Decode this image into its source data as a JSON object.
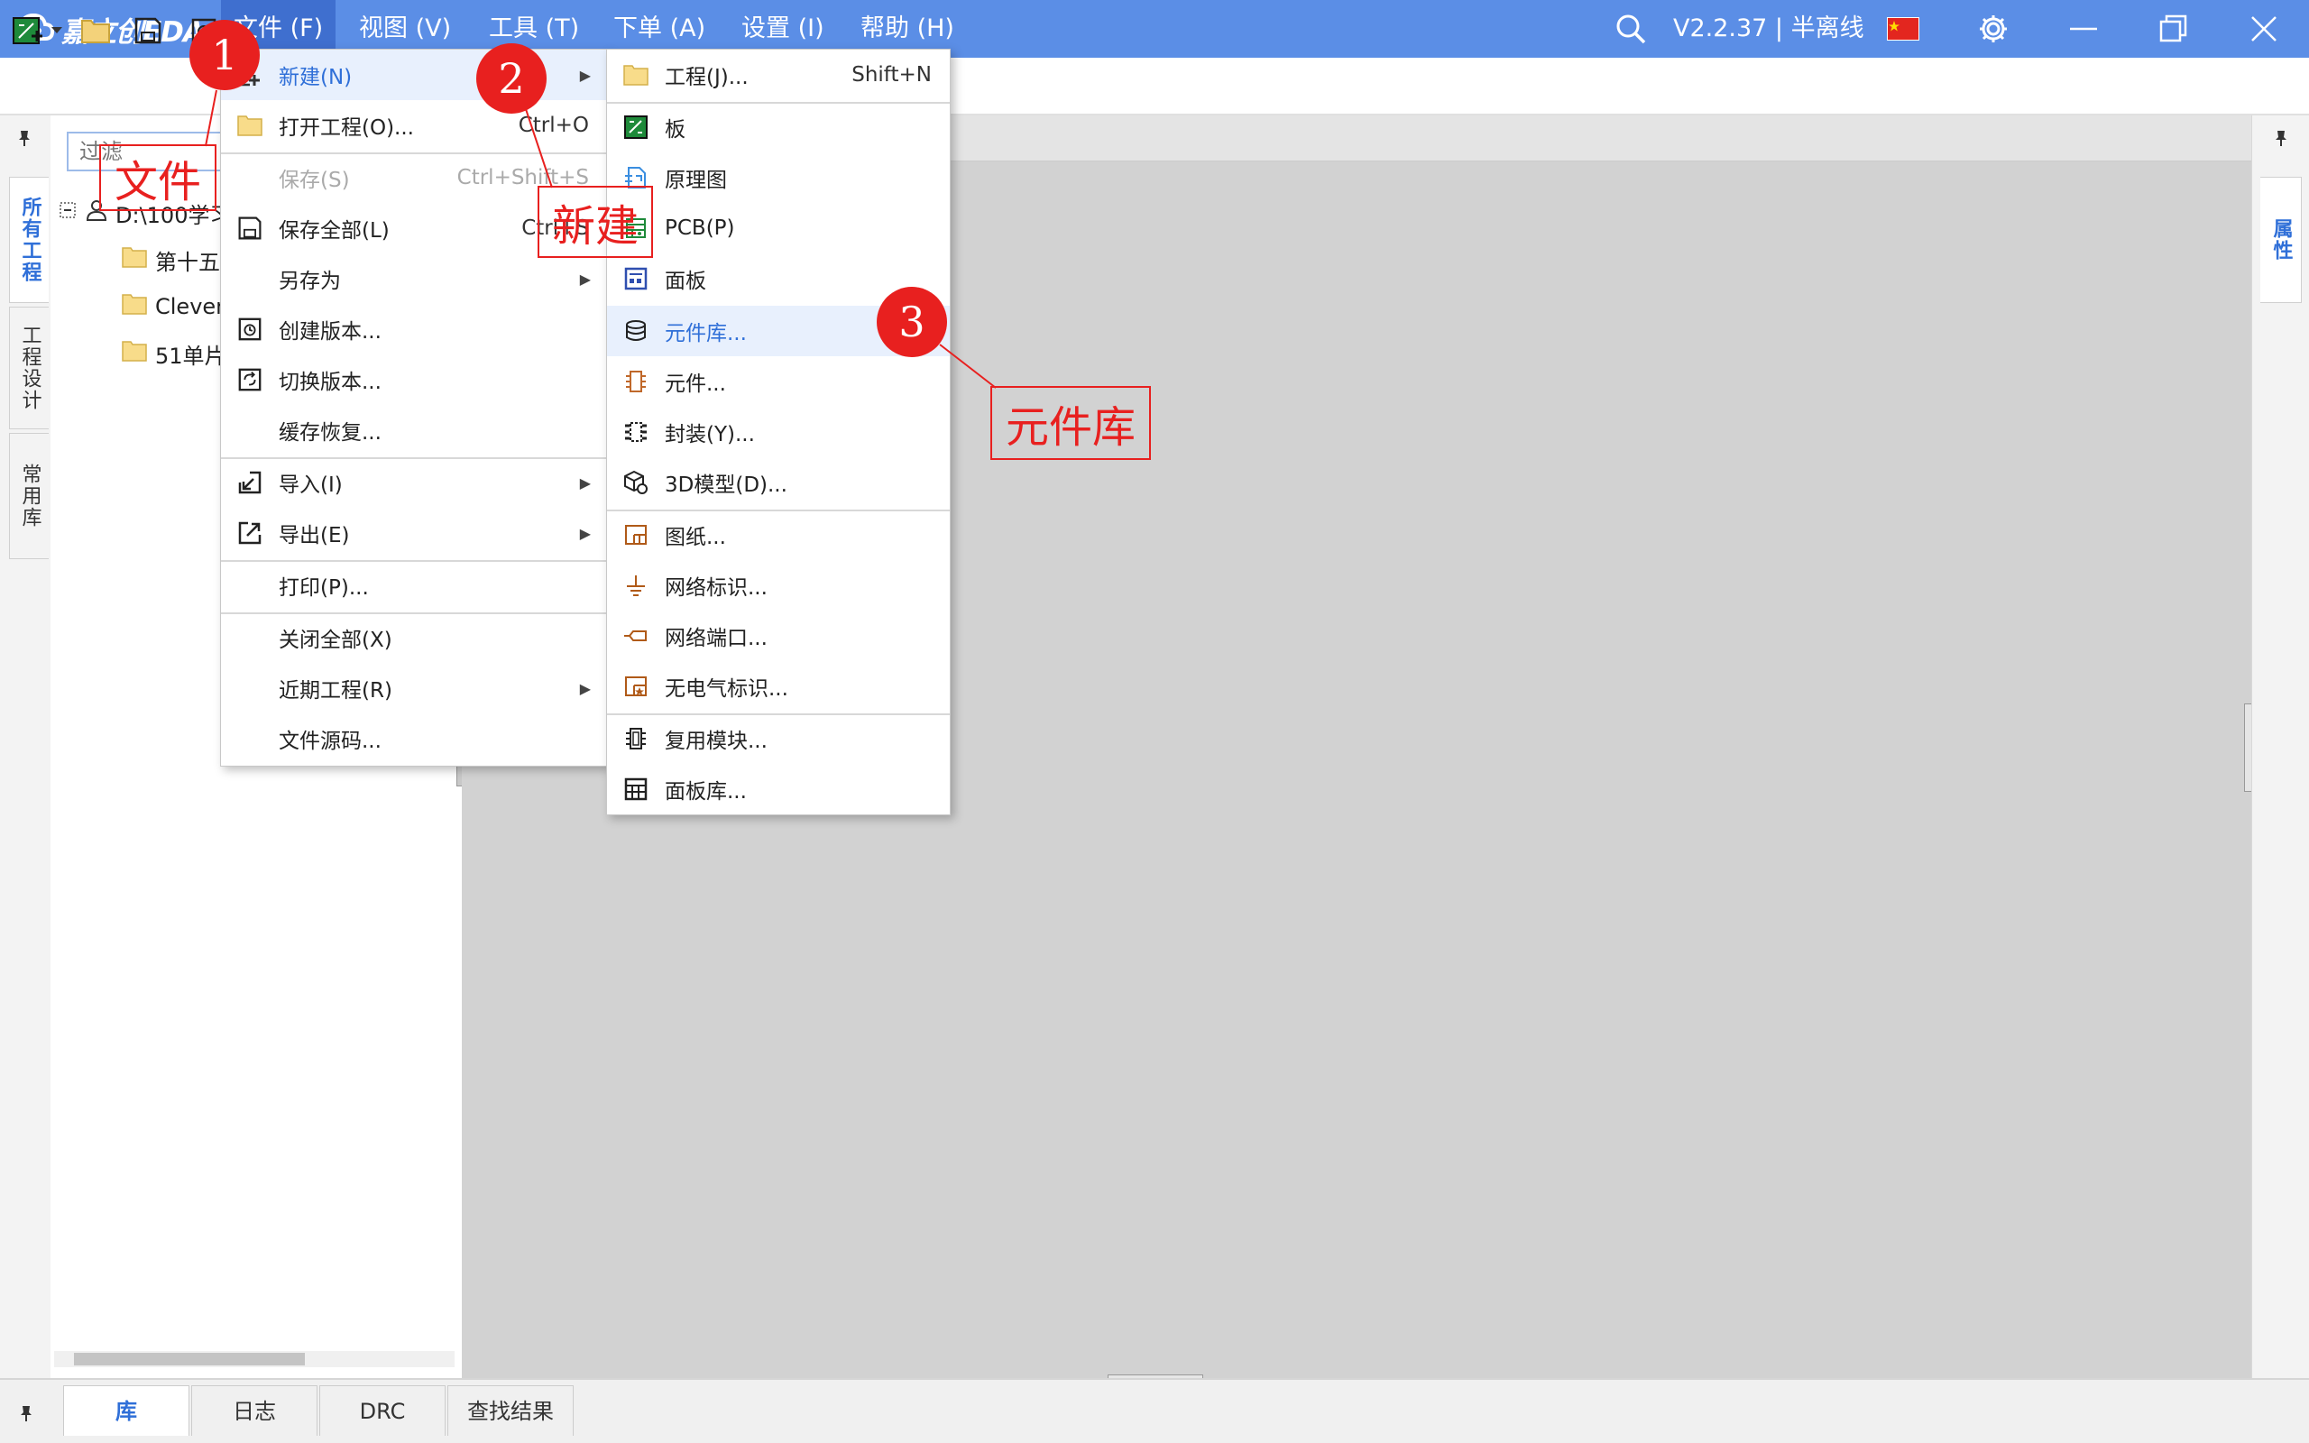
{
  "app": {
    "logo_text": "嘉立创EDA",
    "version_status": "V2.2.37 | 半离线"
  },
  "menubar": [
    "文件 (F)",
    "视图 (V)",
    "工具 (T)",
    "下单 (A)",
    "设置 (I)",
    "帮助 (H)"
  ],
  "project_panel": {
    "filter_placeholder": "过滤",
    "root": "D:\\100学习",
    "items": [
      "第十五",
      "CleverI",
      "51单片"
    ]
  },
  "left_tabs": [
    "所有工程",
    "工程设计",
    "常用库"
  ],
  "right_tabs": [
    "属性"
  ],
  "bottom_tabs": [
    "库",
    "日志",
    "DRC",
    "查找结果"
  ],
  "file_menu": {
    "items": [
      {
        "icon": "new-icon",
        "label": "新建(N)",
        "shortcut": "",
        "submenu": true,
        "state": "highlighted"
      },
      {
        "icon": "folder-open-icon",
        "label": "打开工程(O)...",
        "shortcut": "Ctrl+O"
      },
      {
        "icon": "",
        "label": "保存(S)",
        "shortcut": "Ctrl+Shift+S",
        "state": "disabled"
      },
      {
        "icon": "save-icon",
        "label": "保存全部(L)",
        "shortcut": "Ctrl+S"
      },
      {
        "icon": "",
        "label": "另存为",
        "submenu": true
      },
      {
        "icon": "version-create-icon",
        "label": "创建版本..."
      },
      {
        "icon": "version-switch-icon",
        "label": "切换版本..."
      },
      {
        "icon": "",
        "label": "缓存恢复..."
      },
      {
        "icon": "import-icon",
        "label": "导入(I)",
        "submenu": true
      },
      {
        "icon": "export-icon",
        "label": "导出(E)",
        "submenu": true
      },
      {
        "icon": "",
        "label": "打印(P)..."
      },
      {
        "icon": "",
        "label": "关闭全部(X)"
      },
      {
        "icon": "",
        "label": "近期工程(R)",
        "submenu": true
      },
      {
        "icon": "",
        "label": "文件源码..."
      }
    ]
  },
  "new_submenu": {
    "items": [
      {
        "icon": "project-folder-icon",
        "label": "工程(J)...",
        "shortcut": "Shift+N"
      },
      {
        "icon": "board-icon",
        "label": "板"
      },
      {
        "icon": "schematic-icon",
        "label": "原理图"
      },
      {
        "icon": "pcb-icon",
        "label": "PCB(P)"
      },
      {
        "icon": "panel-icon",
        "label": "面板"
      },
      {
        "icon": "library-icon",
        "label": "元件库...",
        "state": "highlighted"
      },
      {
        "icon": "component-icon",
        "label": "元件..."
      },
      {
        "icon": "footprint-icon",
        "label": "封装(Y)..."
      },
      {
        "icon": "3d-model-icon",
        "label": "3D模型(D)..."
      },
      {
        "icon": "drawing-sheet-icon",
        "label": "图纸..."
      },
      {
        "icon": "net-label-icon",
        "label": "网络标识..."
      },
      {
        "icon": "net-port-icon",
        "label": "网络端口..."
      },
      {
        "icon": "non-electrical-icon",
        "label": "无电气标识..."
      },
      {
        "icon": "reuse-block-icon",
        "label": "复用模块..."
      },
      {
        "icon": "panel-library-icon",
        "label": "面板库..."
      }
    ]
  },
  "annotations": {
    "badges": [
      "1",
      "2",
      "3"
    ],
    "notes": [
      "文件",
      "新建",
      "元件库"
    ]
  },
  "colors": {
    "titlebar": "#5b8ee6",
    "accent": "#2f6fd8",
    "annotation": "#e8201f"
  }
}
